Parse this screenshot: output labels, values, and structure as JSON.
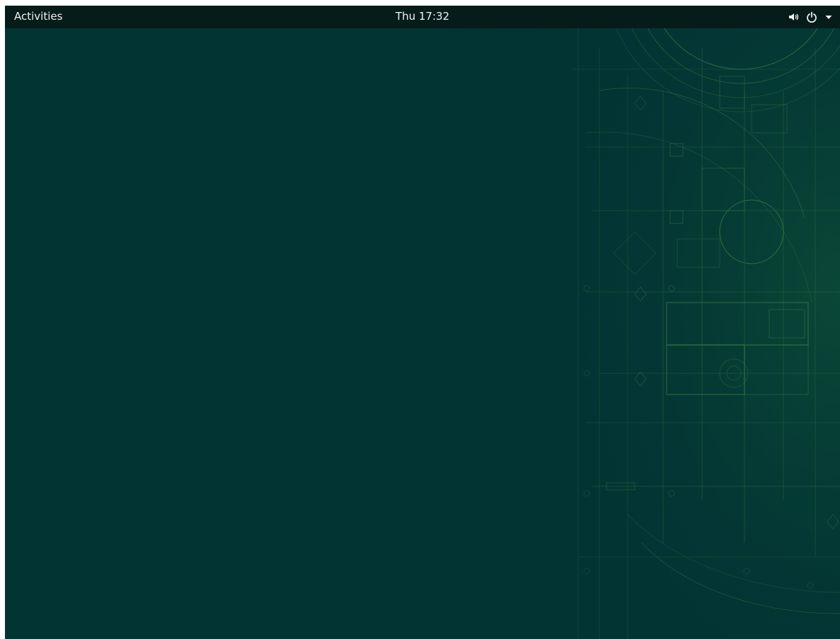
{
  "top_bar": {
    "activities_label": "Activities",
    "clock_text": "Thu 17:32",
    "system_menu": {
      "icons": [
        "volume-icon",
        "power-icon",
        "dropdown-arrow-icon"
      ]
    }
  },
  "desktop": {
    "background_color": "#023433",
    "wallpaper_accent_color": "#4f9a45"
  }
}
